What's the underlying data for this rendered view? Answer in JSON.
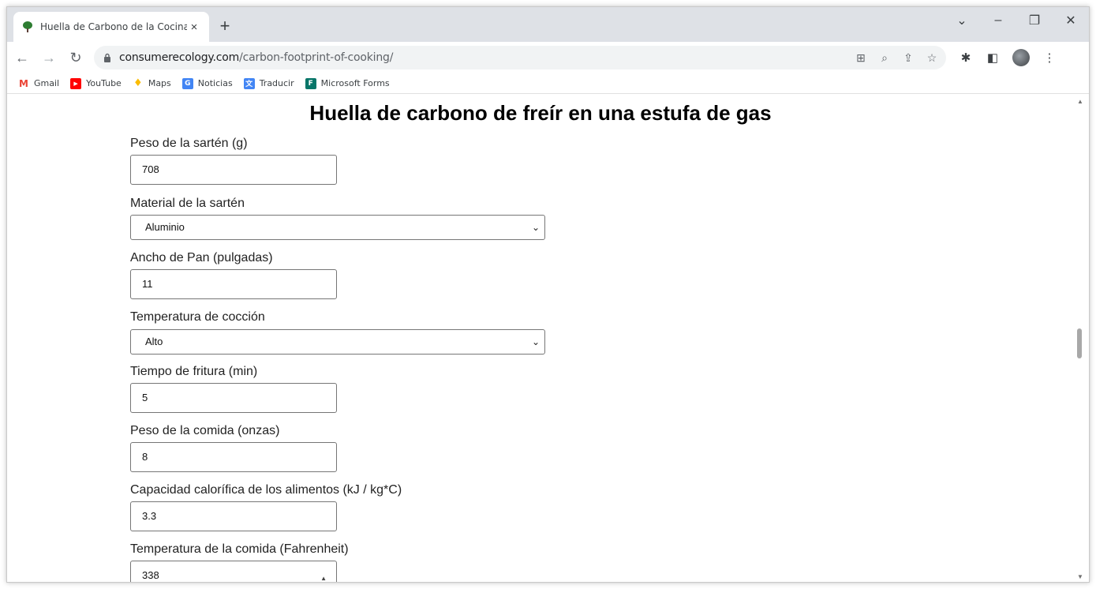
{
  "browser": {
    "tab_title": "Huella de Carbono de la Cocina",
    "tab_close": "×",
    "new_tab": "+",
    "url_domain": "consumerecology.com",
    "url_path": "/carbon-footprint-of-cooking/",
    "bookmarks": [
      {
        "label": "Gmail",
        "color": "#ea4335",
        "icon": "M"
      },
      {
        "label": "YouTube",
        "color": "#ff0000",
        "icon": "▶"
      },
      {
        "label": "Maps",
        "color": "#34a853",
        "icon": "⬤"
      },
      {
        "label": "Noticias",
        "color": "#4285f4",
        "icon": "G"
      },
      {
        "label": "Traducir",
        "color": "#4285f4",
        "icon": "文"
      },
      {
        "label": "Microsoft Forms",
        "color": "#077568",
        "icon": "F"
      }
    ]
  },
  "page": {
    "heading": "Huella de carbono de freír en una estufa de gas",
    "fields": {
      "pan_weight": {
        "label": "Peso de la sartén (g)",
        "value": "708"
      },
      "pan_material": {
        "label": "Material de la sartén",
        "value": "Aluminio"
      },
      "pan_width": {
        "label": "Ancho de Pan (pulgadas)",
        "value": "11"
      },
      "cook_temp": {
        "label": "Temperatura de cocción",
        "value": "Alto"
      },
      "fry_time": {
        "label": "Tiempo de fritura (min)",
        "value": "5"
      },
      "food_weight": {
        "label": "Peso de la comida (onzas)",
        "value": "8"
      },
      "heat_capacity": {
        "label": "Capacidad calorífica de los alimentos (kJ / kg*C)",
        "value": "3.3"
      },
      "food_temp": {
        "label": "Temperatura de la comida (Fahrenheit)",
        "value": "338"
      }
    }
  }
}
